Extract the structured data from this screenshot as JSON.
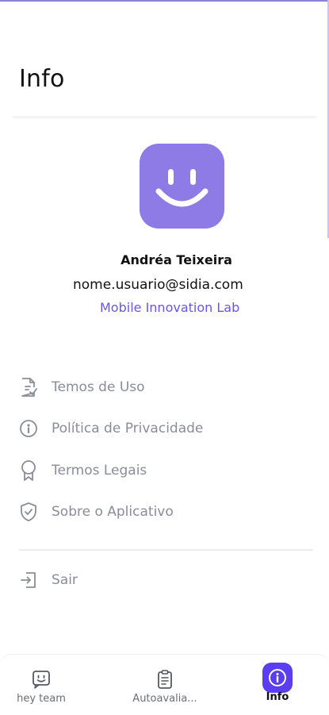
{
  "header": {
    "title": "Info"
  },
  "profile": {
    "name": "Andréa Teixeira",
    "email": "nome.usuario@sidia.com",
    "organization": "Mobile Innovation Lab",
    "avatar_icon": "smiley-face-icon",
    "avatar_color": "#8f7be6"
  },
  "menu": {
    "items": [
      {
        "label": "Temos de Uso",
        "icon": "document-check-icon"
      },
      {
        "label": "Política de Privacidade",
        "icon": "info-circle-icon"
      },
      {
        "label": "Termos Legais",
        "icon": "award-ribbon-icon"
      },
      {
        "label": "Sobre o Aplicativo",
        "icon": "shield-check-icon"
      }
    ],
    "logout": {
      "label": "Sair",
      "icon": "logout-icon"
    }
  },
  "bottom_nav": {
    "items": [
      {
        "label": "hey team",
        "icon": "chat-smile-icon",
        "active": false
      },
      {
        "label": "Autoavalia...",
        "icon": "clipboard-icon",
        "active": false
      },
      {
        "label": "Info",
        "icon": "info-icon",
        "active": true
      }
    ]
  },
  "colors": {
    "accent": "#6a55e8",
    "active_tab": "#5a3ef0",
    "muted_text": "#8a8c98"
  }
}
